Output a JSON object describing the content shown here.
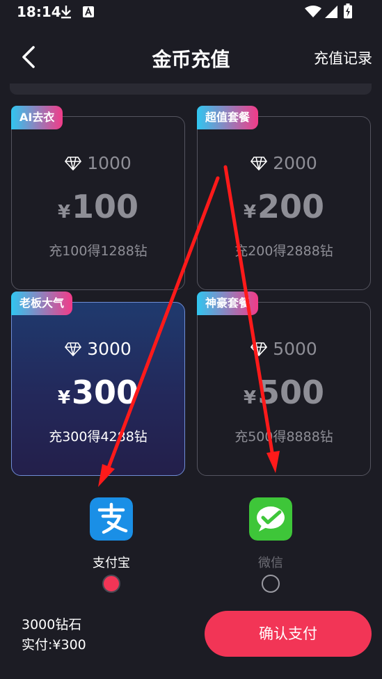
{
  "status_bar": {
    "time": "18:14"
  },
  "header": {
    "back_icon": "chevron-left-icon",
    "title": "金币充值",
    "records_link": "充值记录"
  },
  "packages": [
    {
      "tag": "AI去衣",
      "coins": "1000",
      "currency": "¥",
      "price": "100",
      "bonus": "充100得1288钻",
      "selected": false
    },
    {
      "tag": "超值套餐",
      "coins": "2000",
      "currency": "¥",
      "price": "200",
      "bonus": "充200得2888钻",
      "selected": false
    },
    {
      "tag": "老板大气",
      "coins": "3000",
      "currency": "¥",
      "price": "300",
      "bonus": "充300得4288钻",
      "selected": true
    },
    {
      "tag": "神豪套餐",
      "coins": "5000",
      "currency": "¥",
      "price": "500",
      "bonus": "充500得8888钻",
      "selected": false
    }
  ],
  "payment": {
    "methods": [
      {
        "label": "支付宝",
        "icon": "alipay-icon",
        "selected": true,
        "color": "#1a8fe6"
      },
      {
        "label": "微信",
        "icon": "wechat-icon",
        "selected": false,
        "color": "#3ec639"
      }
    ]
  },
  "summary": {
    "diamonds": "3000钻石",
    "paid": "实付:¥300"
  },
  "confirm_button": "确认支付",
  "colors": {
    "background": "#1c1c24",
    "accent": "#f23556",
    "annotation_arrow": "#ff1a1a"
  }
}
